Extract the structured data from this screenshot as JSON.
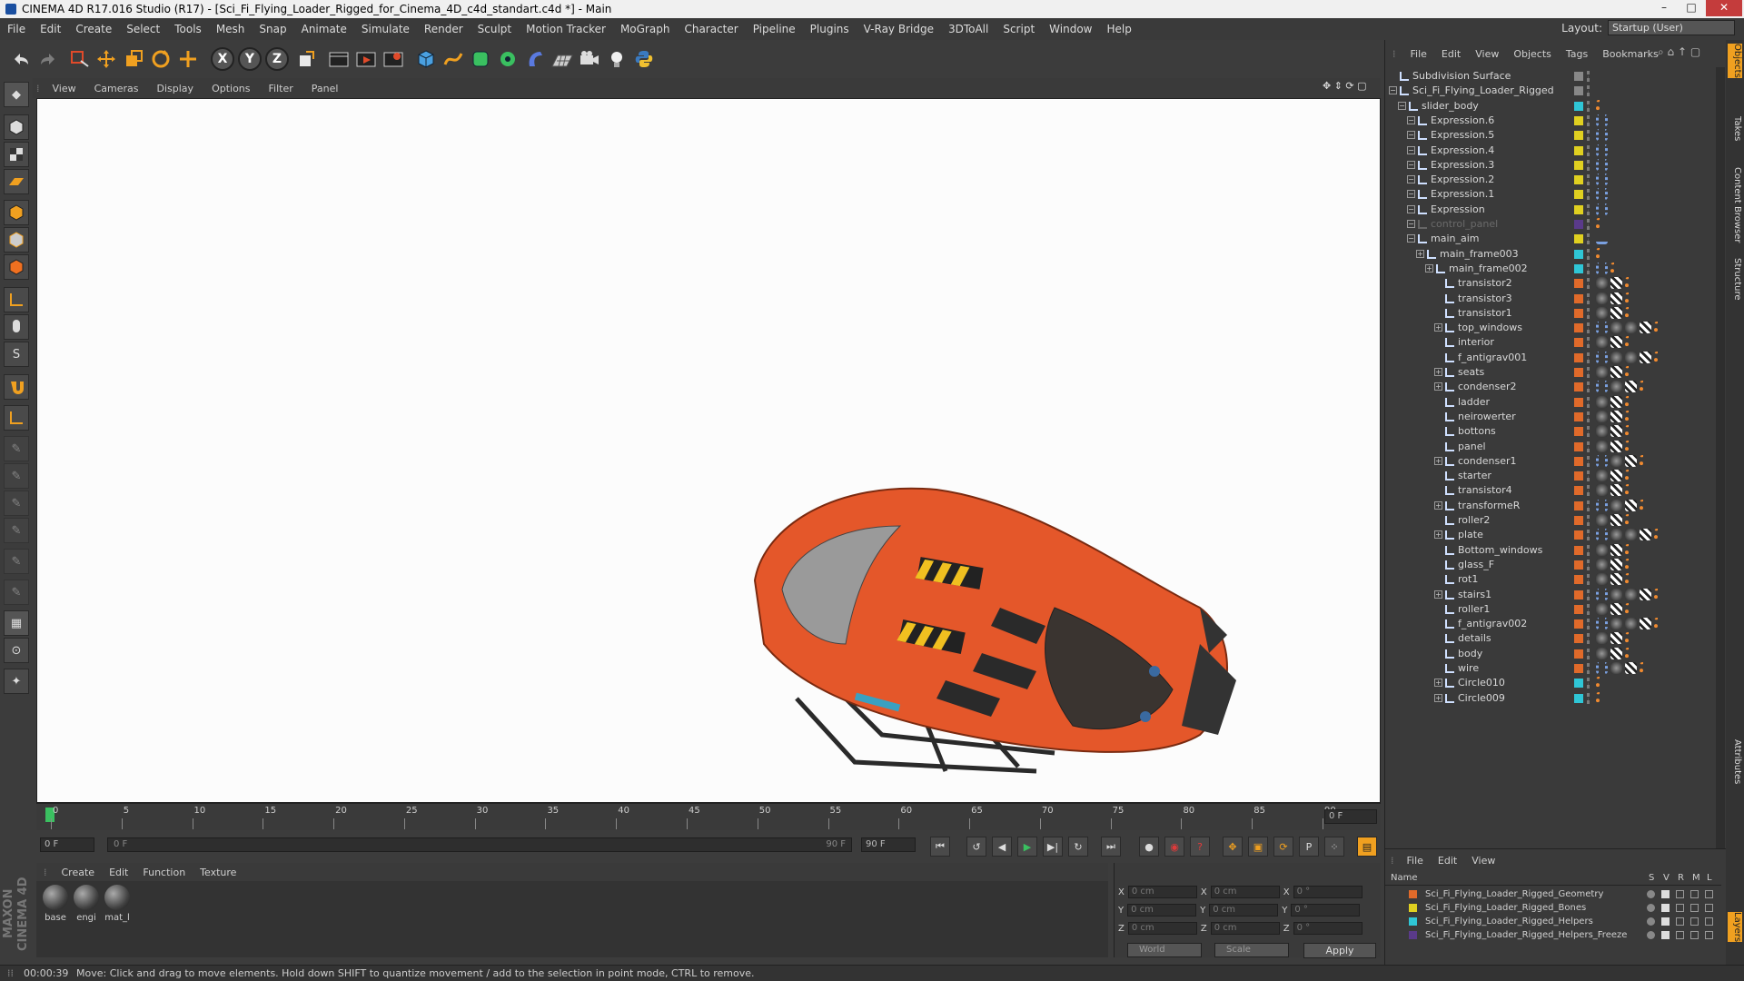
{
  "window": {
    "title": "CINEMA 4D R17.016 Studio (R17) - [Sci_Fi_Flying_Loader_Rigged_for_Cinema_4D_c4d_standart.c4d *] - Main"
  },
  "menubar": [
    "File",
    "Edit",
    "Create",
    "Select",
    "Tools",
    "Mesh",
    "Snap",
    "Animate",
    "Simulate",
    "Render",
    "Sculpt",
    "Motion Tracker",
    "MoGraph",
    "Character",
    "Pipeline",
    "Plugins",
    "V-Ray Bridge",
    "3DToAll",
    "Script",
    "Window",
    "Help"
  ],
  "layout": {
    "label": "Layout:",
    "value": "Startup (User)"
  },
  "toolbar": {
    "axis_x": "X",
    "axis_y": "Y",
    "axis_z": "Z"
  },
  "viewport": {
    "menu": [
      "View",
      "Cameras",
      "Display",
      "Options",
      "Filter",
      "Panel"
    ]
  },
  "timeline": {
    "ticks": [
      "0",
      "5",
      "10",
      "15",
      "20",
      "25",
      "30",
      "35",
      "40",
      "45",
      "50",
      "55",
      "60",
      "65",
      "70",
      "75",
      "80",
      "85",
      "90"
    ],
    "current_frame": "0 F"
  },
  "transport": {
    "start_field": "0 F",
    "range_start": "0 F",
    "range_end": "90 F",
    "end_field": "90 F"
  },
  "material_manager": {
    "menu": [
      "Create",
      "Edit",
      "Function",
      "Texture"
    ],
    "materials": [
      "base",
      "engi",
      "mat_l"
    ]
  },
  "coordinates": {
    "rows": [
      {
        "axis1": "X",
        "v1": "0 cm",
        "axis2": "X",
        "v2": "0 cm",
        "axis3": "X",
        "v3": "0 °"
      },
      {
        "axis1": "Y",
        "v1": "0 cm",
        "axis2": "Y",
        "v2": "0 cm",
        "axis3": "Y",
        "v3": "0 °"
      },
      {
        "axis1": "Z",
        "v1": "0 cm",
        "axis2": "Z",
        "v2": "0 cm",
        "axis3": "Z",
        "v3": "0 °"
      }
    ],
    "mode": "World",
    "scale": "Scale",
    "apply": "Apply"
  },
  "logo": "MAXON CINEMA 4D",
  "status": {
    "time": "00:00:39",
    "message": "Move: Click and drag to move elements. Hold down SHIFT to quantize movement / add to the selection in point mode, CTRL to remove."
  },
  "object_manager": {
    "menu": [
      "File",
      "Edit",
      "View",
      "Objects",
      "Tags",
      "Bookmarks"
    ],
    "objects": [
      {
        "name": "Subdivision Surface",
        "depth": 0,
        "layer": "#888888",
        "greyed": false
      },
      {
        "name": "Sci_Fi_Flying_Loader_Rigged",
        "depth": 0,
        "layer": "#888888",
        "greyed": false
      },
      {
        "name": "slider_body",
        "depth": 1,
        "layer": "#2fc6d6",
        "greyed": false
      },
      {
        "name": "Expression.6",
        "depth": 2,
        "layer": "#e0d020",
        "greyed": false
      },
      {
        "name": "Expression.5",
        "depth": 2,
        "layer": "#e0d020",
        "greyed": false
      },
      {
        "name": "Expression.4",
        "depth": 2,
        "layer": "#e0d020",
        "greyed": false
      },
      {
        "name": "Expression.3",
        "depth": 2,
        "layer": "#e0d020",
        "greyed": false
      },
      {
        "name": "Expression.2",
        "depth": 2,
        "layer": "#e0d020",
        "greyed": false
      },
      {
        "name": "Expression.1",
        "depth": 2,
        "layer": "#e0d020",
        "greyed": false
      },
      {
        "name": "Expression",
        "depth": 2,
        "layer": "#e0d020",
        "greyed": false
      },
      {
        "name": "control_panel",
        "depth": 2,
        "layer": "#5a3a8a",
        "greyed": true
      },
      {
        "name": "main_aim",
        "depth": 2,
        "layer": "#e0d020",
        "greyed": false
      },
      {
        "name": "main_frame003",
        "depth": 3,
        "layer": "#2fc6d6",
        "greyed": false
      },
      {
        "name": "main_frame002",
        "depth": 4,
        "layer": "#2fc6d6",
        "greyed": false
      },
      {
        "name": "transistor2",
        "depth": 5,
        "layer": "#e06a2a",
        "greyed": false
      },
      {
        "name": "transistor3",
        "depth": 5,
        "layer": "#e06a2a",
        "greyed": false
      },
      {
        "name": "transistor1",
        "depth": 5,
        "layer": "#e06a2a",
        "greyed": false
      },
      {
        "name": "top_windows",
        "depth": 5,
        "layer": "#e06a2a",
        "greyed": false
      },
      {
        "name": "interior",
        "depth": 5,
        "layer": "#e06a2a",
        "greyed": false
      },
      {
        "name": "f_antigrav001",
        "depth": 5,
        "layer": "#e06a2a",
        "greyed": false
      },
      {
        "name": "seats",
        "depth": 5,
        "layer": "#e06a2a",
        "greyed": false
      },
      {
        "name": "condenser2",
        "depth": 5,
        "layer": "#e06a2a",
        "greyed": false
      },
      {
        "name": "ladder",
        "depth": 5,
        "layer": "#e06a2a",
        "greyed": false
      },
      {
        "name": "neirowerter",
        "depth": 5,
        "layer": "#e06a2a",
        "greyed": false
      },
      {
        "name": "bottons",
        "depth": 5,
        "layer": "#e06a2a",
        "greyed": false
      },
      {
        "name": "panel",
        "depth": 5,
        "layer": "#e06a2a",
        "greyed": false
      },
      {
        "name": "condenser1",
        "depth": 5,
        "layer": "#e06a2a",
        "greyed": false
      },
      {
        "name": "starter",
        "depth": 5,
        "layer": "#e06a2a",
        "greyed": false
      },
      {
        "name": "transistor4",
        "depth": 5,
        "layer": "#e06a2a",
        "greyed": false
      },
      {
        "name": "transformeR",
        "depth": 5,
        "layer": "#e06a2a",
        "greyed": false
      },
      {
        "name": "roller2",
        "depth": 5,
        "layer": "#e06a2a",
        "greyed": false
      },
      {
        "name": "plate",
        "depth": 5,
        "layer": "#e06a2a",
        "greyed": false
      },
      {
        "name": "Bottom_windows",
        "depth": 5,
        "layer": "#e06a2a",
        "greyed": false
      },
      {
        "name": "glass_F",
        "depth": 5,
        "layer": "#e06a2a",
        "greyed": false
      },
      {
        "name": "rot1",
        "depth": 5,
        "layer": "#e06a2a",
        "greyed": false
      },
      {
        "name": "stairs1",
        "depth": 5,
        "layer": "#e06a2a",
        "greyed": false
      },
      {
        "name": "roller1",
        "depth": 5,
        "layer": "#e06a2a",
        "greyed": false
      },
      {
        "name": "f_antigrav002",
        "depth": 5,
        "layer": "#e06a2a",
        "greyed": false
      },
      {
        "name": "details",
        "depth": 5,
        "layer": "#e06a2a",
        "greyed": false
      },
      {
        "name": "body",
        "depth": 5,
        "layer": "#e06a2a",
        "greyed": false
      },
      {
        "name": "wire",
        "depth": 5,
        "layer": "#e06a2a",
        "greyed": false
      },
      {
        "name": "Circle010",
        "depth": 5,
        "layer": "#2fc6d6",
        "greyed": false
      },
      {
        "name": "Circle009",
        "depth": 5,
        "layer": "#2fc6d6",
        "greyed": false
      }
    ]
  },
  "layer_manager": {
    "menu": [
      "File",
      "Edit",
      "View"
    ],
    "columns": {
      "name": "Name",
      "s": "S",
      "v": "V",
      "r": "R",
      "m": "M",
      "l": "L"
    },
    "layers": [
      {
        "name": "Sci_Fi_Flying_Loader_Rigged_Geometry",
        "color": "#e06a2a"
      },
      {
        "name": "Sci_Fi_Flying_Loader_Rigged_Bones",
        "color": "#e0d020"
      },
      {
        "name": "Sci_Fi_Flying_Loader_Rigged_Helpers",
        "color": "#2fc6d6"
      },
      {
        "name": "Sci_Fi_Flying_Loader_Rigged_Helpers_Freeze",
        "color": "#5a3a8a"
      }
    ]
  },
  "side_tabs": [
    "Objects",
    "Takes",
    "Content Browser",
    "Structure",
    "Attributes",
    "Layers"
  ]
}
